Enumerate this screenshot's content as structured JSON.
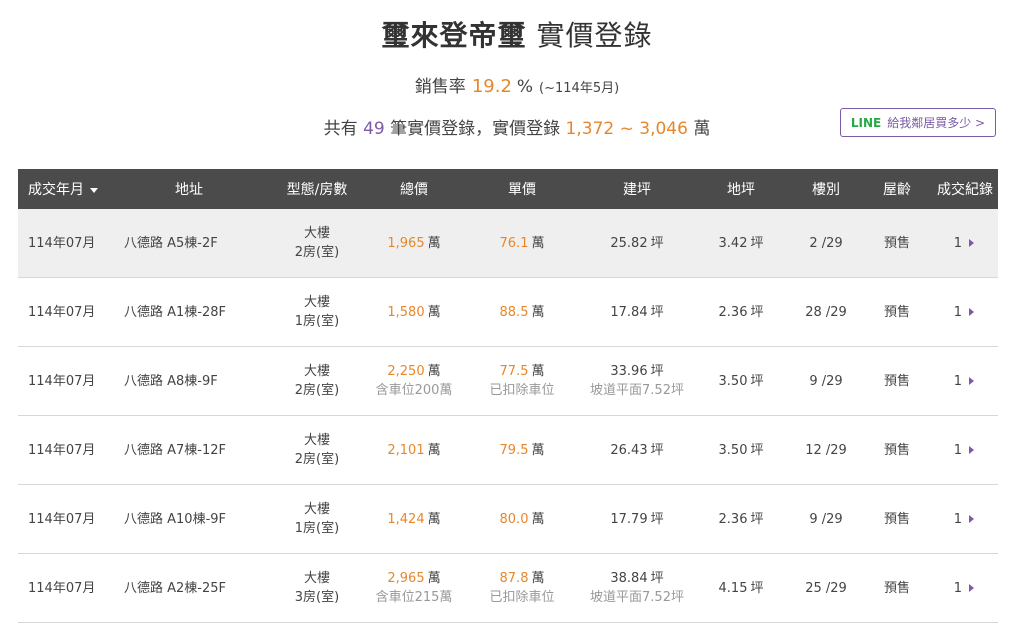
{
  "header": {
    "name": "璽來登帝璽",
    "suffix": "實價登錄"
  },
  "sales": {
    "label": "銷售率",
    "rate": "19.2",
    "percent_sign": "%",
    "period": "(~114年5月)"
  },
  "summary": {
    "prefix": "共有",
    "count": "49",
    "mid": "筆實價登錄，實價登錄",
    "range": "1,372 ~ 3,046",
    "unit": "萬"
  },
  "line_button": {
    "brand": "LINE",
    "label": "給我鄰居買多少 >"
  },
  "colors": {
    "accent_orange": "#e8872a",
    "accent_purple": "#7b5aa6",
    "header_bg": "#4b4b4b",
    "line_green": "#2aa845"
  },
  "table": {
    "headers": {
      "date": "成交年月",
      "address": "地址",
      "type": "型態/房數",
      "total": "總價",
      "unit_price": "單價",
      "area": "建坪",
      "land": "地坪",
      "floor": "樓別",
      "age": "屋齡",
      "record": "成交紀錄"
    },
    "rows": [
      {
        "date": "114年07月",
        "address": "八德路 A5棟-2F",
        "type": "大樓",
        "rooms": "2房(室)",
        "total": "1,965",
        "total_unit": "萬",
        "total_note": "",
        "price": "76.1",
        "price_unit": "萬",
        "price_note": "",
        "area": "25.82",
        "area_unit": "坪",
        "area_note": "",
        "land": "3.42",
        "land_unit": "坪",
        "floor": "2 /29",
        "age": "預售",
        "count": "1"
      },
      {
        "date": "114年07月",
        "address": "八德路 A1棟-28F",
        "type": "大樓",
        "rooms": "1房(室)",
        "total": "1,580",
        "total_unit": "萬",
        "total_note": "",
        "price": "88.5",
        "price_unit": "萬",
        "price_note": "",
        "area": "17.84",
        "area_unit": "坪",
        "area_note": "",
        "land": "2.36",
        "land_unit": "坪",
        "floor": "28 /29",
        "age": "預售",
        "count": "1"
      },
      {
        "date": "114年07月",
        "address": "八德路 A8棟-9F",
        "type": "大樓",
        "rooms": "2房(室)",
        "total": "2,250",
        "total_unit": "萬",
        "total_note": "含車位200萬",
        "price": "77.5",
        "price_unit": "萬",
        "price_note": "已扣除車位",
        "area": "33.96",
        "area_unit": "坪",
        "area_note": "坡道平面7.52坪",
        "land": "3.50",
        "land_unit": "坪",
        "floor": "9 /29",
        "age": "預售",
        "count": "1"
      },
      {
        "date": "114年07月",
        "address": "八德路 A7棟-12F",
        "type": "大樓",
        "rooms": "2房(室)",
        "total": "2,101",
        "total_unit": "萬",
        "total_note": "",
        "price": "79.5",
        "price_unit": "萬",
        "price_note": "",
        "area": "26.43",
        "area_unit": "坪",
        "area_note": "",
        "land": "3.50",
        "land_unit": "坪",
        "floor": "12 /29",
        "age": "預售",
        "count": "1"
      },
      {
        "date": "114年07月",
        "address": "八德路 A10棟-9F",
        "type": "大樓",
        "rooms": "1房(室)",
        "total": "1,424",
        "total_unit": "萬",
        "total_note": "",
        "price": "80.0",
        "price_unit": "萬",
        "price_note": "",
        "area": "17.79",
        "area_unit": "坪",
        "area_note": "",
        "land": "2.36",
        "land_unit": "坪",
        "floor": "9 /29",
        "age": "預售",
        "count": "1"
      },
      {
        "date": "114年07月",
        "address": "八德路 A2棟-25F",
        "type": "大樓",
        "rooms": "3房(室)",
        "total": "2,965",
        "total_unit": "萬",
        "total_note": "含車位215萬",
        "price": "87.8",
        "price_unit": "萬",
        "price_note": "已扣除車位",
        "area": "38.84",
        "area_unit": "坪",
        "area_note": "坡道平面7.52坪",
        "land": "4.15",
        "land_unit": "坪",
        "floor": "25 /29",
        "age": "預售",
        "count": "1"
      }
    ]
  }
}
